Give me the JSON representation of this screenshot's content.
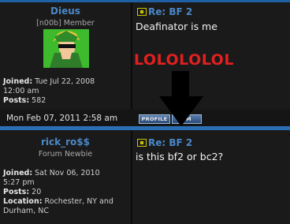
{
  "posts": [
    {
      "username": "Dieus",
      "rank": "[n00b] Member",
      "joined_label": "Joined:",
      "joined_value": "Tue Jul 22, 2008",
      "joined_time": "12:00 am",
      "posts_label": "Posts:",
      "posts_value": "582",
      "title": "Re: BF 2",
      "body": "Deafinator is me",
      "extra_text": "LOLOLOLOL",
      "date": "Mon Feb 07, 2011 2:58 am",
      "profile_button": "PROFILE",
      "pm_button": "PM"
    },
    {
      "username": "rick_ro$$",
      "rank": "Forum Newbie",
      "joined_label": "Joined:",
      "joined_value": "Sat Nov 06, 2010",
      "joined_time": "5:27 pm",
      "posts_label": "Posts:",
      "posts_value": "20",
      "location_label": "Location:",
      "location_value": "Rochester, NY and",
      "location_value2": "Durham, NC",
      "title": "Re: BF 2",
      "body": "is this bf2 or bc2?"
    }
  ],
  "colors": {
    "username": "#4a88c8",
    "accent_bar": "#2b6fb5",
    "lol_text": "#e02020"
  }
}
